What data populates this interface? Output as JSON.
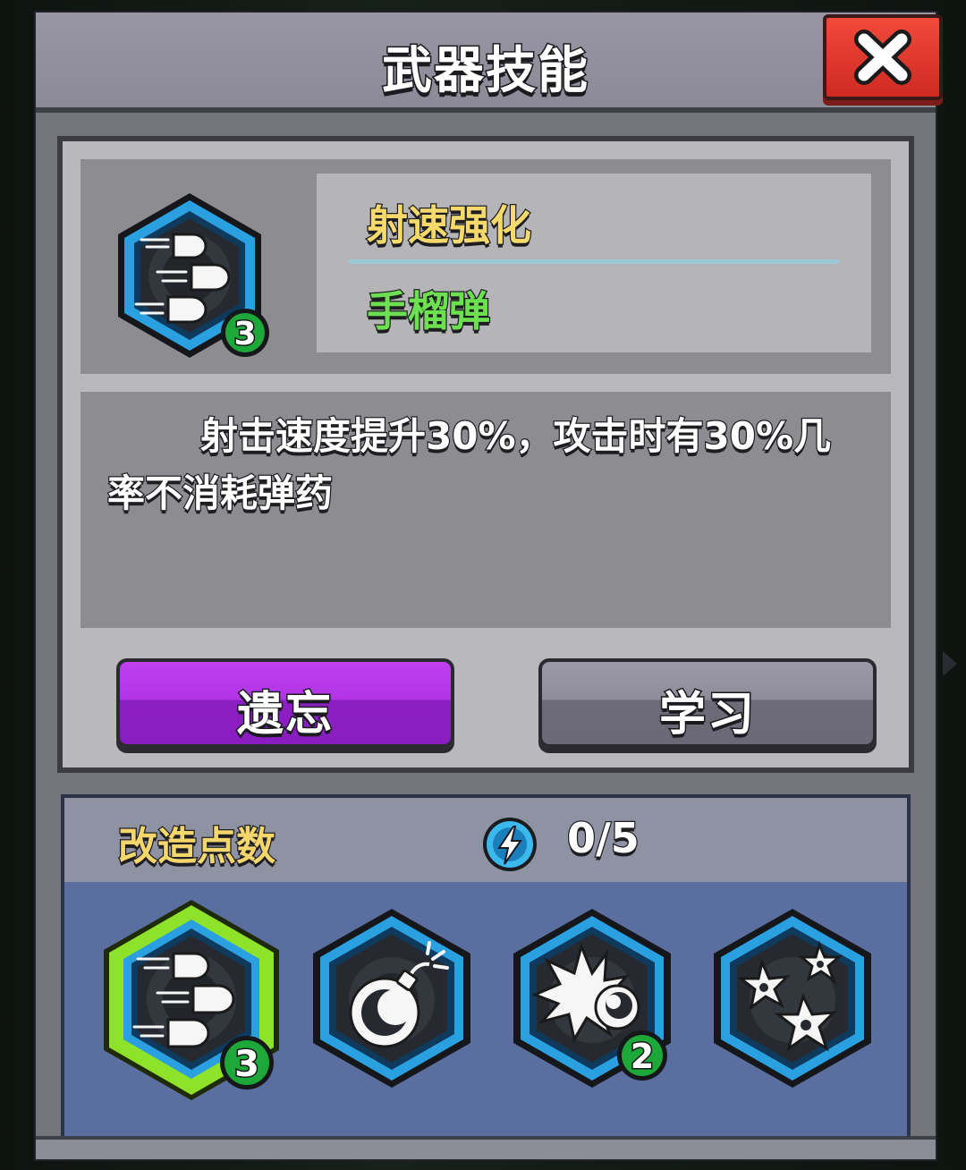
{
  "dialog": {
    "title": "武器技能",
    "close_icon": "close-x-icon"
  },
  "skill": {
    "name": "射速强化",
    "weapon": "手榴弹",
    "level": "3",
    "icon": "bullets-speed-icon",
    "description": "射击速度提升30%，攻击时有30%几率不消耗弹药"
  },
  "actions": {
    "forget_label": "遗忘",
    "learn_label": "学习"
  },
  "modification": {
    "label": "改造点数",
    "points": "0/5",
    "points_icon": "lightning-energy-icon"
  },
  "skill_slots": [
    {
      "icon": "bullets-speed-icon",
      "level": "3",
      "selected": true
    },
    {
      "icon": "bomb-icon",
      "level": null,
      "selected": false
    },
    {
      "icon": "explosion-shot-icon",
      "level": "2",
      "selected": false
    },
    {
      "icon": "stars-burst-icon",
      "level": null,
      "selected": false
    }
  ],
  "colors": {
    "skill_name": "#f5d96a",
    "weapon_name": "#6ce050",
    "forget_button": "#b034e6",
    "learn_button": "#8e8d99",
    "close_button": "#e23a2e",
    "hex_border": "#2aa0e0",
    "selected_glow": "#8ee22a",
    "level_badge": "#1fa83a"
  }
}
